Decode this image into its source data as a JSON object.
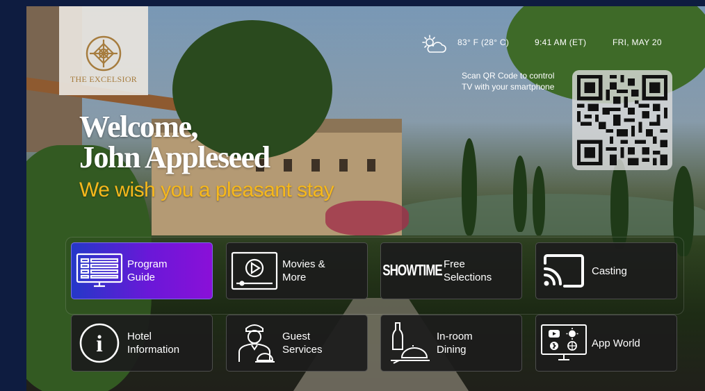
{
  "brand": {
    "name": "THE EXCELSIOR",
    "accent_color": "#a67c3e"
  },
  "status_bar": {
    "weather_icon": "partly-cloudy-icon",
    "temperature": "83° F (28° C)",
    "time": "9:41 AM (ET)",
    "date": "FRI, MAY 20"
  },
  "qr": {
    "caption_line1": "Scan QR Code to control",
    "caption_line2": "TV with your smartphone"
  },
  "welcome": {
    "line1": "Welcome,",
    "line2": "John Appleseed",
    "tagline": "We wish you a pleasant stay",
    "tagline_color": "#f6b81c"
  },
  "menu": {
    "items": [
      {
        "label": "Program\nGuide",
        "icon": "program-guide-icon",
        "selected": true
      },
      {
        "label": "Movies &\nMore",
        "icon": "movies-play-icon",
        "selected": false
      },
      {
        "label": "Free\nSelections",
        "icon": "showtime-logo",
        "icon_text": "SHOWTIME",
        "selected": false
      },
      {
        "label": "Casting",
        "icon": "cast-icon",
        "selected": false
      },
      {
        "label": "Hotel\nInformation",
        "icon": "info-icon",
        "selected": false
      },
      {
        "label": "Guest\nServices",
        "icon": "concierge-icon",
        "selected": false
      },
      {
        "label": "In-room\nDining",
        "icon": "dining-icon",
        "selected": false
      },
      {
        "label": "App World",
        "icon": "app-world-icon",
        "selected": false
      }
    ],
    "selected_gradient": [
      "#2438c8",
      "#8a10d8"
    ]
  }
}
